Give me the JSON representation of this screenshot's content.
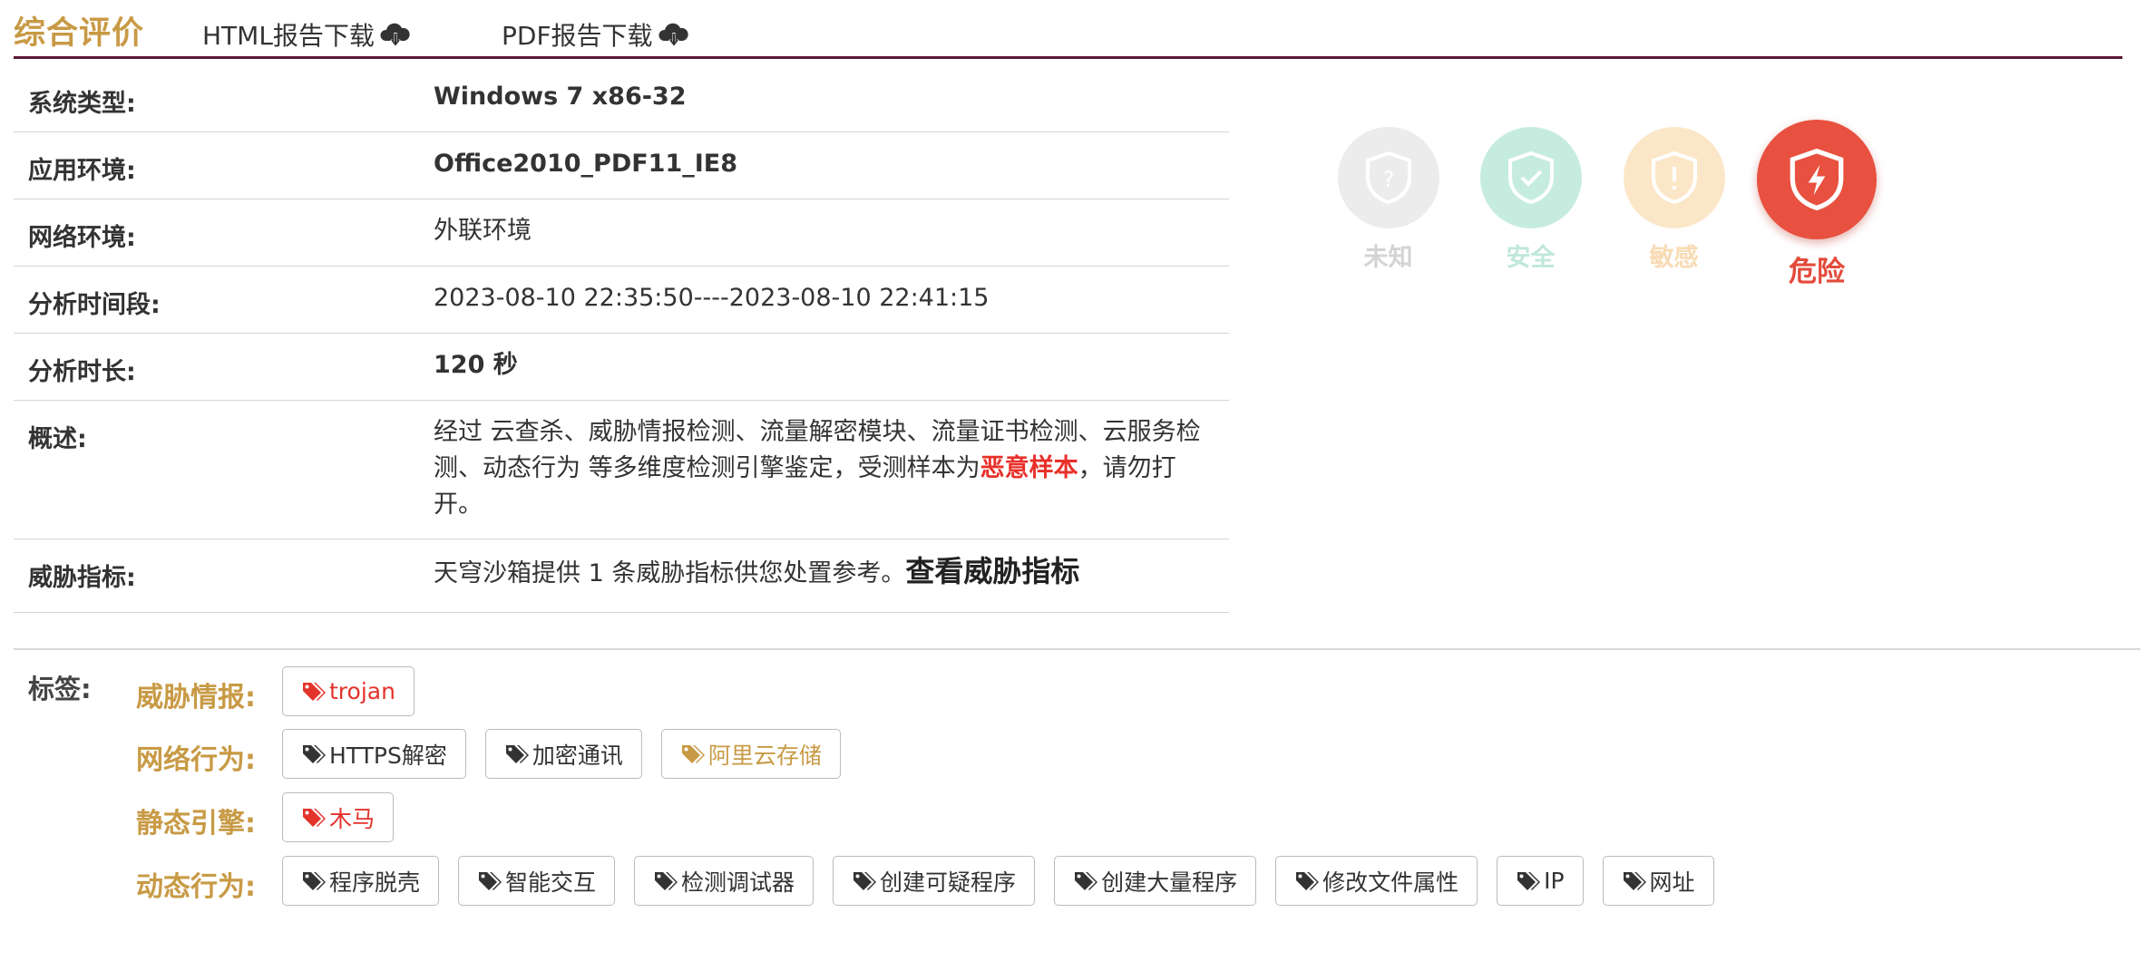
{
  "header": {
    "title": "综合评价",
    "html_download": "HTML报告下载",
    "pdf_download": "PDF报告下载"
  },
  "info": {
    "rows": [
      {
        "key": "系统类型:",
        "value": "Windows 7 x86-32"
      },
      {
        "key": "应用环境:",
        "value": "Office2010_PDF11_IE8"
      },
      {
        "key": "网络环境:",
        "value": "外联环境"
      },
      {
        "key": "分析时间段:",
        "value": "2023-08-10 22:35:50----2023-08-10 22:41:15"
      },
      {
        "key": "分析时长:",
        "value": "120 秒"
      }
    ],
    "summary": {
      "key": "概述:",
      "prefix": "经过 云查杀、威胁情报检测、流量解密模块、流量证书检测、云服务检测、动态行为 等多维度检测引擎鉴定，受测样本为",
      "verdict": "恶意样本",
      "suffix": "，请勿打开。"
    },
    "indicator": {
      "key": "威胁指标:",
      "text": "天穹沙箱提供 1 条威胁指标供您处置参考。",
      "link": "查看威胁指标"
    }
  },
  "status": {
    "unknown": "未知",
    "safe": "安全",
    "sensitive": "敏感",
    "danger": "危险",
    "active": "danger"
  },
  "tags": {
    "label": "标签:",
    "threat_intel": {
      "label": "威胁情报:",
      "items": [
        "trojan"
      ]
    },
    "network": {
      "label": "网络行为:",
      "items": [
        "HTTPS解密",
        "加密通讯",
        "阿里云存储"
      ]
    },
    "static": {
      "label": "静态引擎:",
      "items": [
        "木马"
      ]
    },
    "dynamic": {
      "label": "动态行为:",
      "items": [
        "程序脱壳",
        "智能交互",
        "检测调试器",
        "创建可疑程序",
        "创建大量程序",
        "修改文件属性",
        "IP",
        "网址"
      ]
    }
  },
  "colors": {
    "accent_gold": "#c89a45",
    "header_rule": "#5a1a35",
    "danger_red": "#e8503f",
    "malicious_text": "#e8302a"
  }
}
